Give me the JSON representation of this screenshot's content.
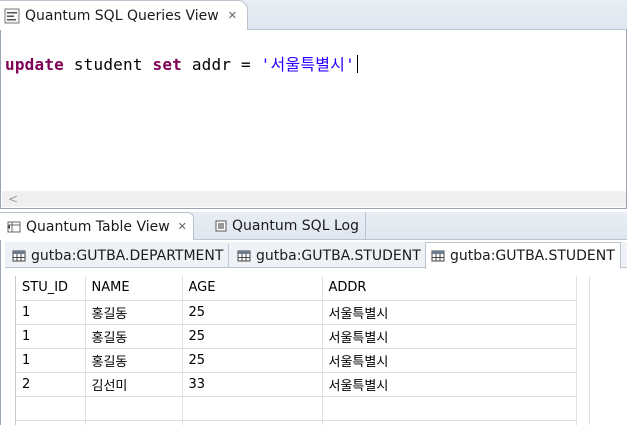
{
  "top_view": {
    "tab_title": "Quantum SQL Queries View",
    "editor": {
      "kw_update": "update",
      "t1": " student ",
      "kw_set": "set",
      "t2": " addr = ",
      "string": "'서울특별시'"
    },
    "scroll_arrow": "<"
  },
  "bottom_view": {
    "tabs": [
      {
        "label": "Quantum Table View"
      },
      {
        "label": "Quantum SQL Log"
      }
    ],
    "subtabs": [
      {
        "label": "gutba:GUTBA.DEPARTMENT"
      },
      {
        "label": "gutba:GUTBA.STUDENT"
      },
      {
        "label": "gutba:GUTBA.STUDENT"
      }
    ],
    "table": {
      "headers": [
        "STU_ID",
        "NAME",
        "AGE",
        "ADDR"
      ],
      "rows": [
        [
          "1",
          "홍길동",
          "25",
          "서울특별시"
        ],
        [
          "1",
          "홍길동",
          "25",
          "서울특별시"
        ],
        [
          "1",
          "홍길동",
          "25",
          "서울특별시"
        ],
        [
          "2",
          "김선미",
          "33",
          "서울특별시"
        ]
      ]
    }
  },
  "colors": {
    "keyword": "#7f0055",
    "string": "#2a00ff",
    "tab_gradient_top": "#e9eef5"
  }
}
